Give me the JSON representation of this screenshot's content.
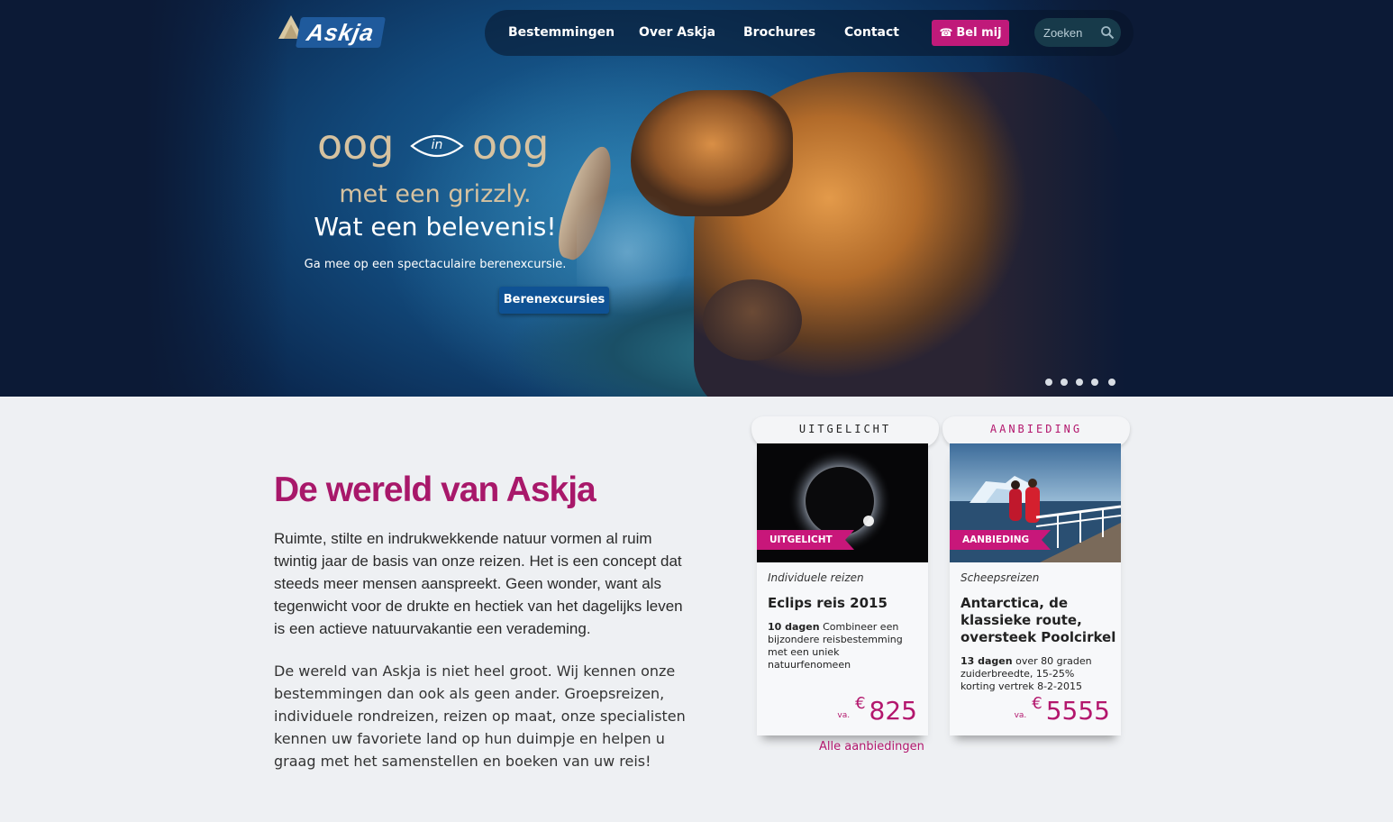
{
  "brand": {
    "logo_text": "Askja",
    "accent": "#c01a7a",
    "title_color": "#a8186a",
    "nav_bg": "#0c1a36"
  },
  "nav": {
    "items": [
      {
        "label": "Bestemmingen"
      },
      {
        "label": "Over Askja"
      },
      {
        "label": "Brochures"
      },
      {
        "label": "Contact"
      }
    ],
    "call_button": {
      "label": "Bel mij",
      "icon": "phone-icon"
    },
    "search": {
      "placeholder": "Zoeken",
      "value": "",
      "icon": "search-icon"
    }
  },
  "hero": {
    "line1_left": "oog",
    "line1_eye": "in",
    "line1_right": "oog",
    "line2": "met een grizzly.",
    "line3": "Wat een belevenis!",
    "subtitle": "Ga mee op een spectaculaire berenexcursie.",
    "cta": "Berenexcursies",
    "slide_count": 5,
    "active_slide": 1
  },
  "intro": {
    "title": "De wereld van Askja",
    "paragraph1": "Ruimte, stilte en indrukwekkende natuur vormen al ruim twintig jaar de basis van onze reizen. Het is een concept dat steeds meer mensen aanspreekt. Geen wonder, want als tegenwicht voor de drukte en hectiek van het dagelijks leven is een actieve natuurvakantie een verademing.",
    "paragraph2": "De wereld van Askja is niet heel groot. Wij kennen onze bestemmingen dan ook als geen ander. Groepsreizen, individuele rondreizen, reizen op maat, onze specialisten kennen uw favoriete land op hun duimpje en helpen u graag met het samenstellen en boeken van uw reis!"
  },
  "cards": [
    {
      "tab": "UITGELICHT",
      "tab_color": "#222222",
      "ribbon": "UITGELICHT",
      "category": "Individuele reizen",
      "title": "Eclips reis 2015",
      "days": "10 dagen",
      "description": "Combineer een bijzondere reisbestemming met een uniek natuurfenomeen",
      "price_prefix": "va.",
      "currency": "€",
      "price": "825"
    },
    {
      "tab": "AANBIEDING",
      "tab_color": "#b3176d",
      "ribbon": "AANBIEDING",
      "category": "Scheepsreizen",
      "title": "Antarctica, de klassieke route, oversteek Poolcirkel",
      "days": "13 dagen",
      "description": "over 80 graden zuiderbreedte, 15-25% korting vertrek 8-2-2015",
      "price_prefix": "va.",
      "currency": "€",
      "price": "5555"
    }
  ],
  "all_offers_link": "Alle aanbiedingen"
}
